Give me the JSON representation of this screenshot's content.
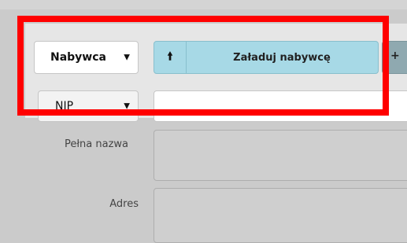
{
  "buyer": {
    "selected": "Nabywca"
  },
  "tax_id": {
    "selected": "NIP",
    "value": ""
  },
  "load_button": {
    "label": "Załaduj nabywcę",
    "icon": "arrow-up-icon"
  },
  "fields": {
    "full_name_label": "Pełna nazwa",
    "address_label": "Adres",
    "full_name_value": "",
    "address_value": ""
  },
  "colors": {
    "highlight": "#ff0000",
    "button": "#a7d9e6",
    "panel": "#e6e6e6",
    "background": "#cbcbcb"
  }
}
